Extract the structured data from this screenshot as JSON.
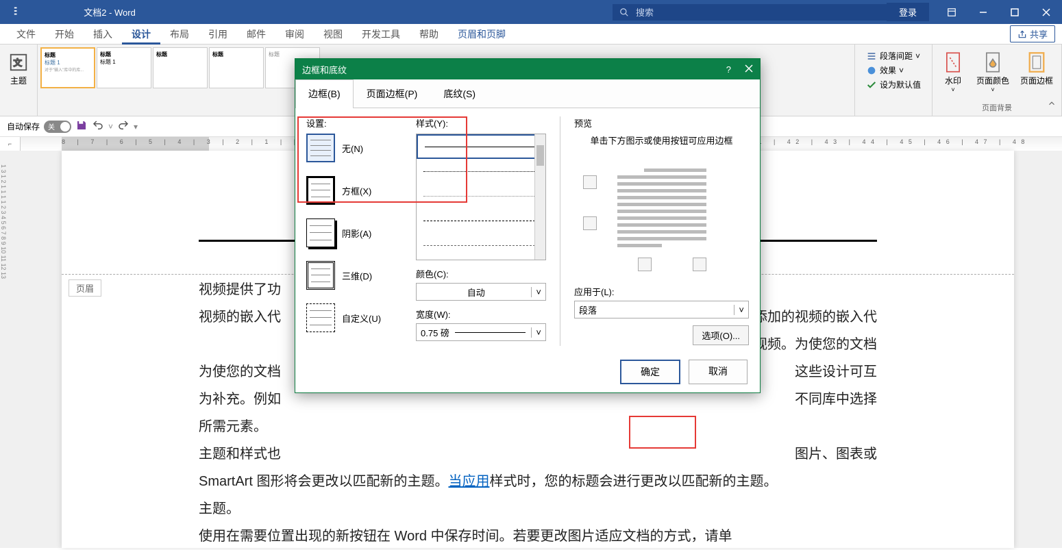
{
  "titlebar": {
    "doc_title": "文档2  -  Word",
    "search_placeholder": "搜索",
    "login": "登录"
  },
  "tabs": {
    "file": "文件",
    "home": "开始",
    "insert": "插入",
    "design": "设计",
    "layout": "布局",
    "references": "引用",
    "mail": "邮件",
    "review": "审阅",
    "view": "视图",
    "developer": "开发工具",
    "help": "帮助",
    "headerfooter": "页眉和页脚",
    "share": "共享"
  },
  "ribbon": {
    "themes": "主题",
    "theme_items": [
      "标题",
      "标题",
      "标题",
      "标题"
    ],
    "theme_sub": "标题 1",
    "para_spacing": "段落间距",
    "effects": "效果",
    "set_default": "设为默认值",
    "watermark": "水印",
    "page_color": "页面颜色",
    "page_border": "页面边框",
    "group_bg": "页面背景"
  },
  "qat": {
    "autosave": "自动保存",
    "toggle_label": "关"
  },
  "dialog": {
    "title": "边框和底纹",
    "tabs": {
      "border": "边框(B)",
      "page_border": "页面边框(P)",
      "shading": "底纹(S)"
    },
    "setting_label": "设置:",
    "settings": {
      "none": "无(N)",
      "box": "方框(X)",
      "shadow": "阴影(A)",
      "threed": "三维(D)",
      "custom": "自定义(U)"
    },
    "style_label": "样式(Y):",
    "color_label": "颜色(C):",
    "color_value": "自动",
    "width_label": "宽度(W):",
    "width_value": "0.75 磅",
    "preview_label": "预览",
    "preview_help": "单击下方图示或使用按钮可应用边框",
    "apply_label": "应用于(L):",
    "apply_value": "段落",
    "options": "选项(O)...",
    "ok": "确定",
    "cancel": "取消"
  },
  "page": {
    "header_tag": "页眉",
    "body_p1_a": "视频提供了功",
    "body_p1_b": "在想要添加的视频的嵌入代",
    "body_p1_c": "文档的视频。为使您的文档",
    "body_p1_d": "这些设计可互为补充。例如",
    "body_p1_e": "不同库中选择所需元素。",
    "body_p2_a": "主题和样式也",
    "body_p2_b": "图片、图表或 SmartArt 图形将会更改以匹配新的主题。",
    "body_p2_link": "当应用",
    "body_p2_c": "样式时，您的标题会进行更改以匹配新的主题。",
    "body_p3": "使用在需要位置出现的新按钮在 Word 中保存时间。若要更改图片适应文档的方式，请单"
  },
  "ruler": "8 | 7 | 6 | 5 | 4 | 3 | 2 | 1 |   | 1 | 2 | 3 | 4 | 5 | 6 | 7 |                                                                 | 35 | 36 | 37 | 38 | 39 | 40 | 41 | 42 | 43 | 44 | 45 | 46 | 47 | 48"
}
